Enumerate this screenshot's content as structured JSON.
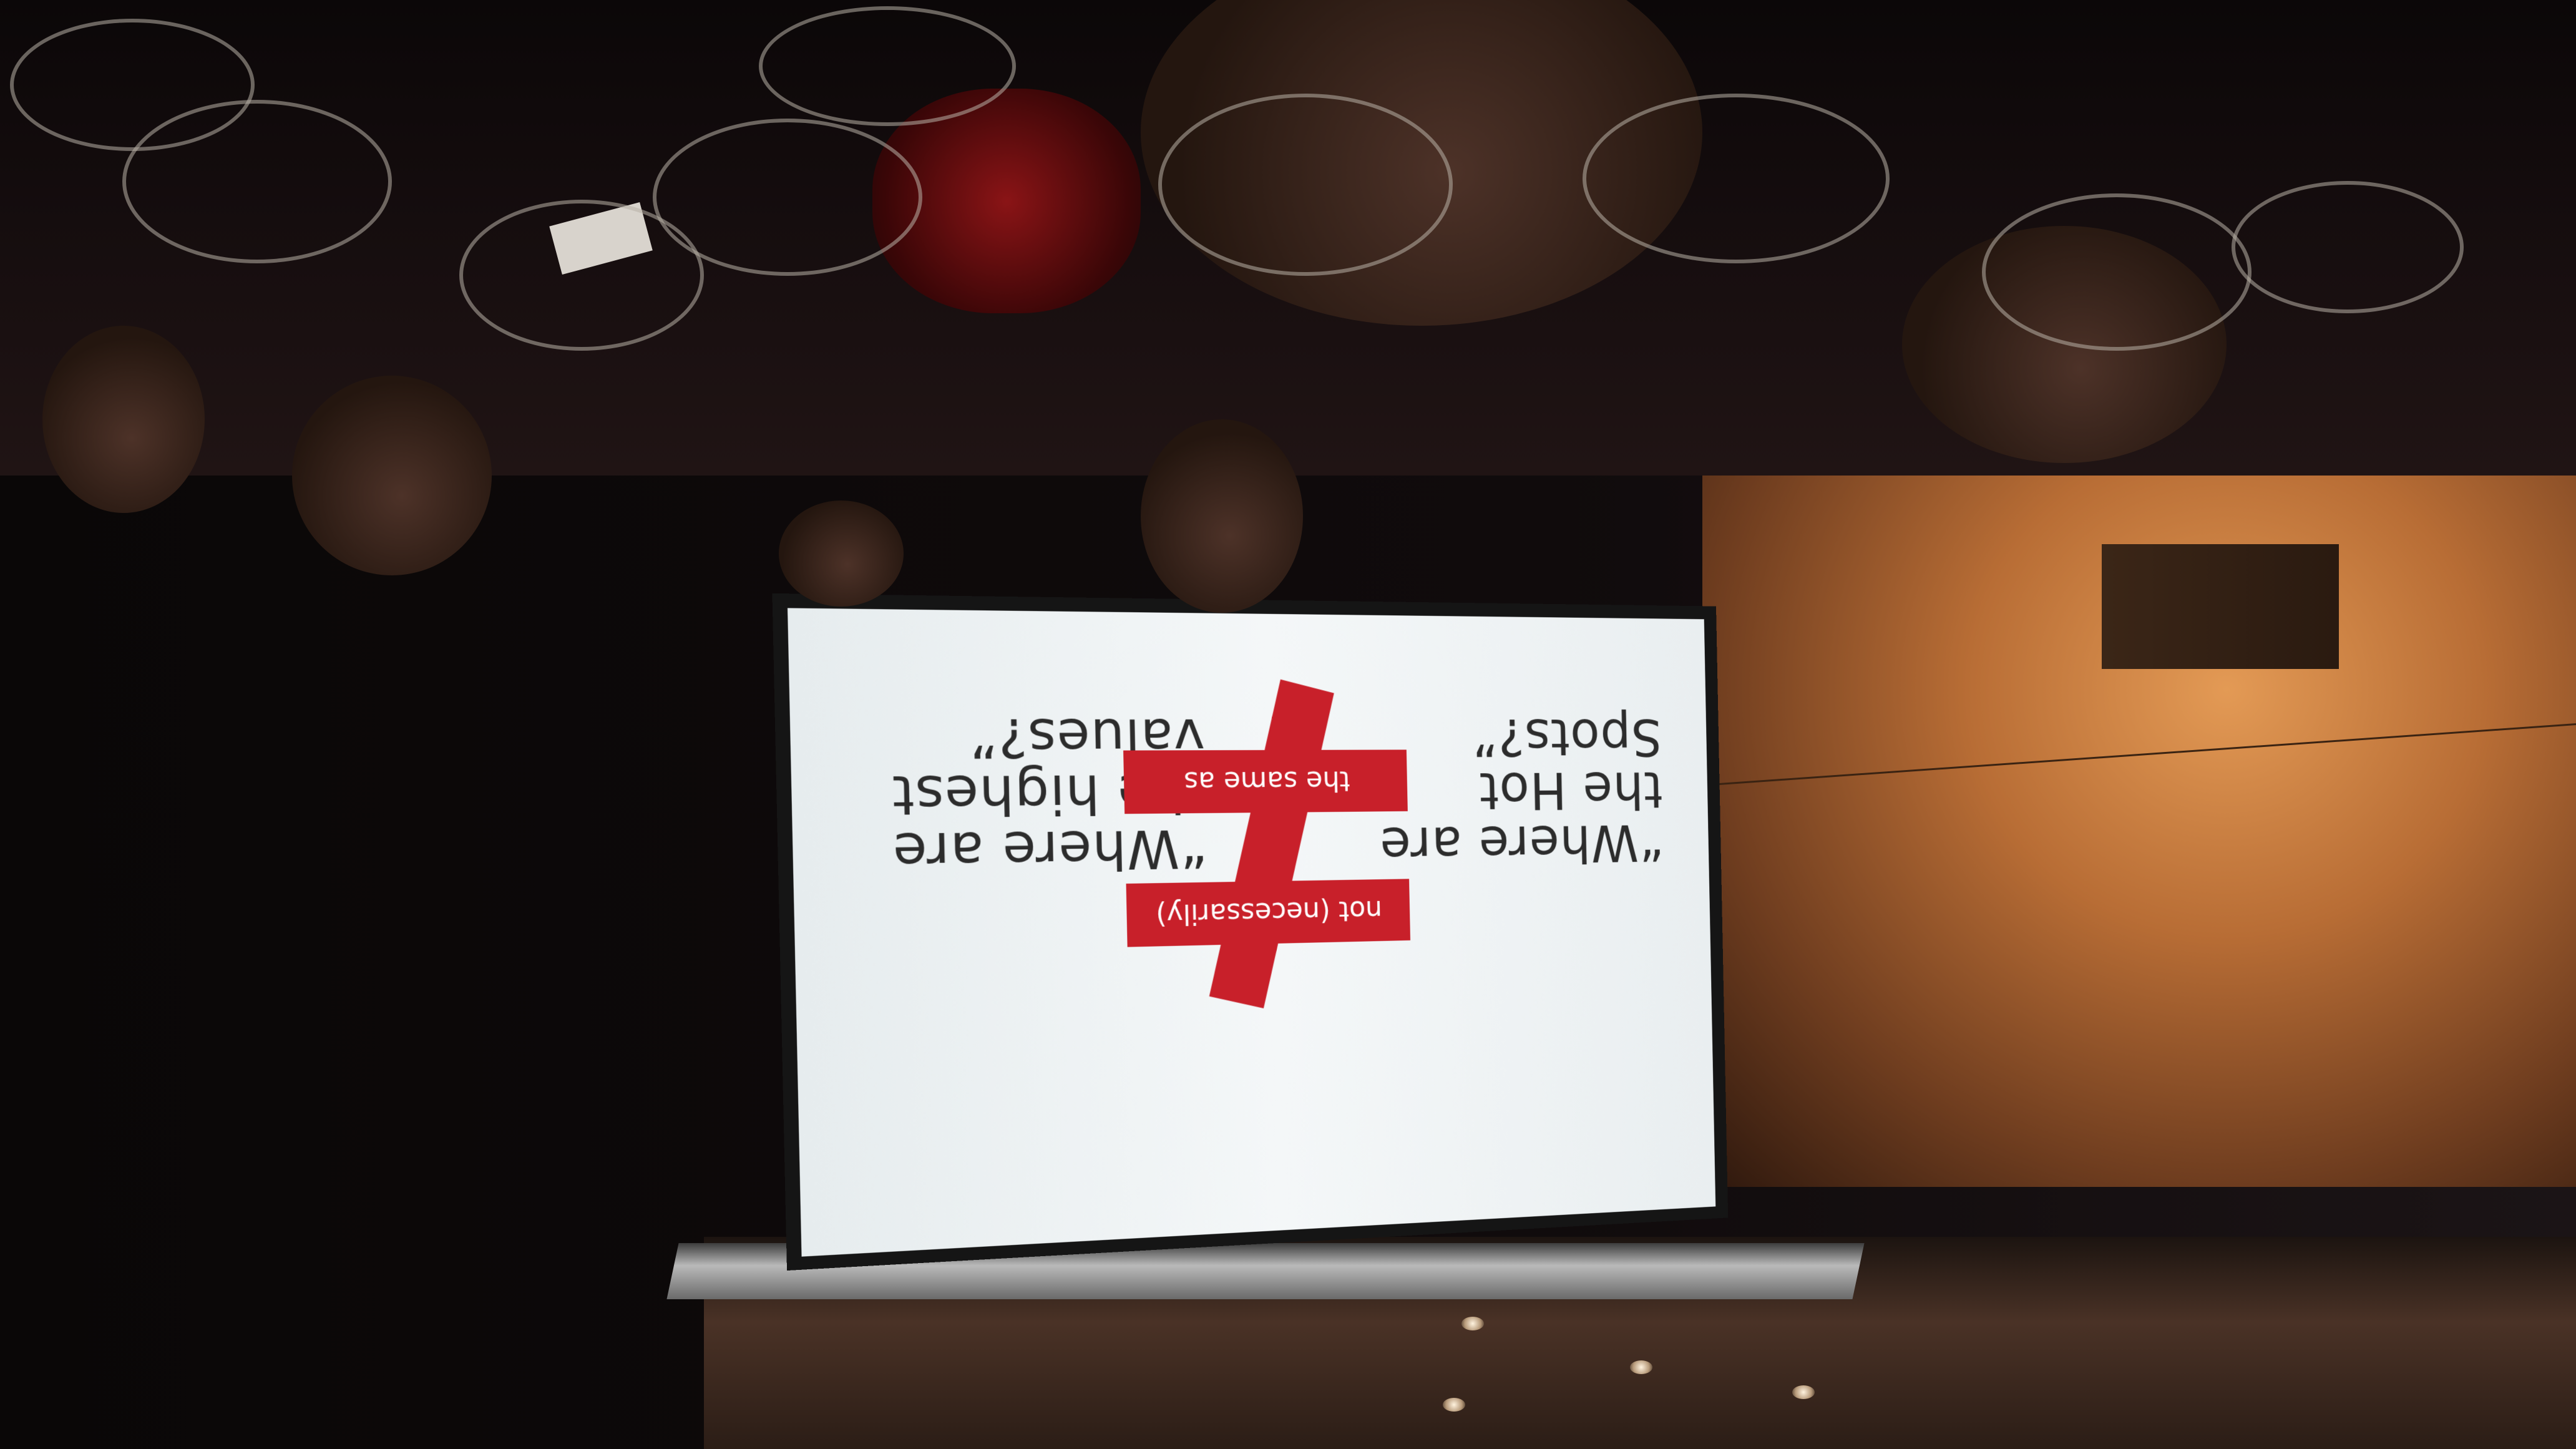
{
  "slide": {
    "quote_left": "“Where are\nthe Hot\nSpots?”",
    "quote_right": "“Where are\nthe highest\nvalues?”",
    "bar_top_prefix": "not",
    "bar_top_paren": "(necessarily)",
    "bar_bottom": "the same as"
  },
  "colors": {
    "accent_red": "#c8202a",
    "screen_white": "#f4f7f8",
    "text_dark": "#2c2c2c"
  }
}
